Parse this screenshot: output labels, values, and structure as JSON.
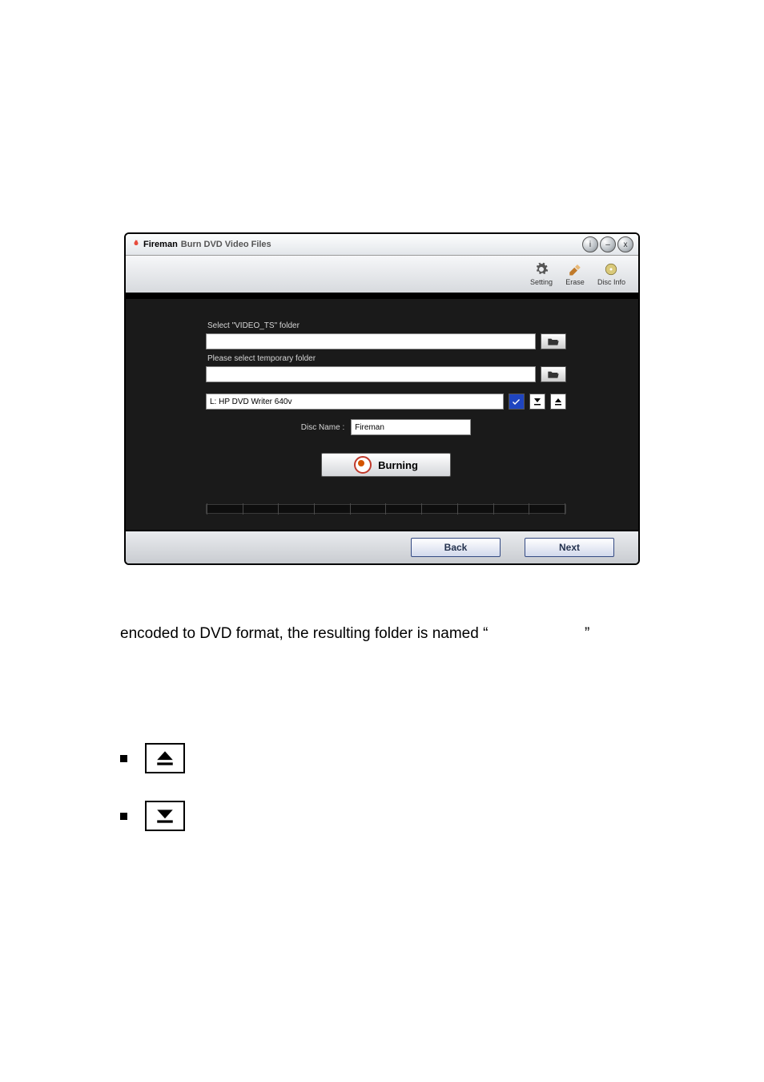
{
  "window": {
    "brand": "Fireman",
    "title_rest": "Burn DVD  Video Files",
    "controls": {
      "info_glyph": "i",
      "min_glyph": "–",
      "close_glyph": "x"
    }
  },
  "toolbar": {
    "setting": {
      "label": "Setting"
    },
    "erase": {
      "label": "Erase"
    },
    "discinfo": {
      "label": "Disc Info"
    }
  },
  "content": {
    "video_ts_label": "Select \"VIDEO_TS\" folder",
    "video_ts_value": "",
    "temp_label": "Please select temporary folder",
    "temp_value": "",
    "drive_select_value": "L: HP       DVD Writer 640v",
    "disc_name_label": "Disc Name :",
    "disc_name_value": "Fireman",
    "burn_label": "Burning"
  },
  "footer": {
    "back_label": "Back",
    "next_label": "Next"
  },
  "page_text": {
    "line": "encoded to DVD format, the resulting folder is named “",
    "line_end": "”"
  }
}
